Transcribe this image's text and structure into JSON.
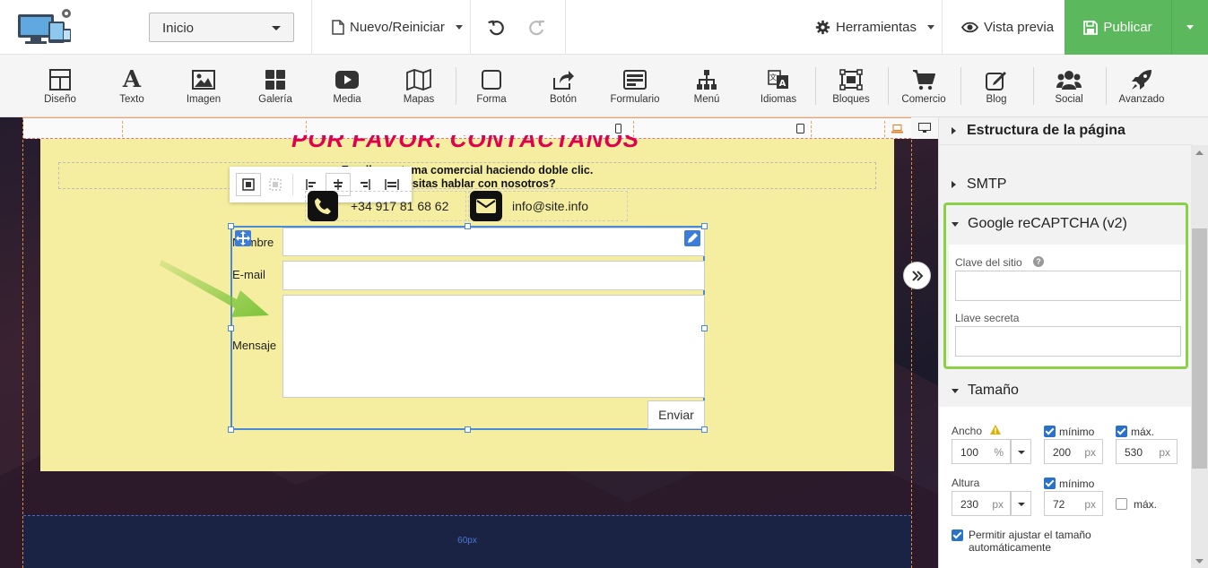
{
  "topbar": {
    "page_select": "Inicio",
    "new_reset": "Nuevo/Reiniciar",
    "tools": "Herramientas",
    "preview": "Vista previa",
    "publish": "Publicar"
  },
  "toolbar": {
    "items": [
      {
        "label": "Diseño",
        "icon": "layout-icon"
      },
      {
        "label": "Texto",
        "icon": "text-icon"
      },
      {
        "label": "Imagen",
        "icon": "image-icon"
      },
      {
        "label": "Galería",
        "icon": "gallery-icon"
      },
      {
        "label": "Media",
        "icon": "video-icon"
      },
      {
        "label": "Mapas",
        "icon": "map-icon"
      },
      {
        "label": "Forma",
        "icon": "shape-icon"
      },
      {
        "label": "Botón",
        "icon": "button-icon"
      },
      {
        "label": "Formulario",
        "icon": "form-icon"
      },
      {
        "label": "Menú",
        "icon": "menu-icon"
      },
      {
        "label": "Idiomas",
        "icon": "language-icon"
      },
      {
        "label": "Bloques",
        "icon": "blocks-icon"
      },
      {
        "label": "Comercio",
        "icon": "cart-icon"
      },
      {
        "label": "Blog",
        "icon": "blog-icon"
      },
      {
        "label": "Social",
        "icon": "social-icon"
      },
      {
        "label": "Avanzado",
        "icon": "rocket-icon"
      }
    ]
  },
  "canvas": {
    "title_partial": "POR FAVOR, CONTÁCTANOS",
    "text_line1": "Escriba su tema comercial haciendo doble clic.",
    "text_line2": "¿Necesitas hablar con nosotros?",
    "phone": "+34 917 81 68 62",
    "email": "info@site.info",
    "form": {
      "name_label": "Nombre",
      "email_label": "E-mail",
      "message_label": "Mensaje",
      "send": "Enviar"
    },
    "spacer_label": "60px"
  },
  "panel": {
    "structure": "Estructura de la página",
    "smtp": "SMTP",
    "recaptcha": "Google reCAPTCHA (v2)",
    "site_key": "Clave del sitio",
    "secret_key": "Llave secreta",
    "size": "Tamaño",
    "width_label": "Ancho",
    "width_value": "100",
    "width_unit": "%",
    "min": "mínimo",
    "max": "máx.",
    "width_min": "200",
    "width_max": "530",
    "height_label": "Altura",
    "height_value": "230",
    "height_min": "72",
    "unit_px": "px",
    "auto_size": "Permitir ajustar el tamaño automáticamente"
  },
  "colors": {
    "publish_green": "#5cb85c",
    "highlight_green": "#8cd048",
    "selection_blue": "#4a8ad6",
    "canvas_yellow": "#f5eea0"
  }
}
